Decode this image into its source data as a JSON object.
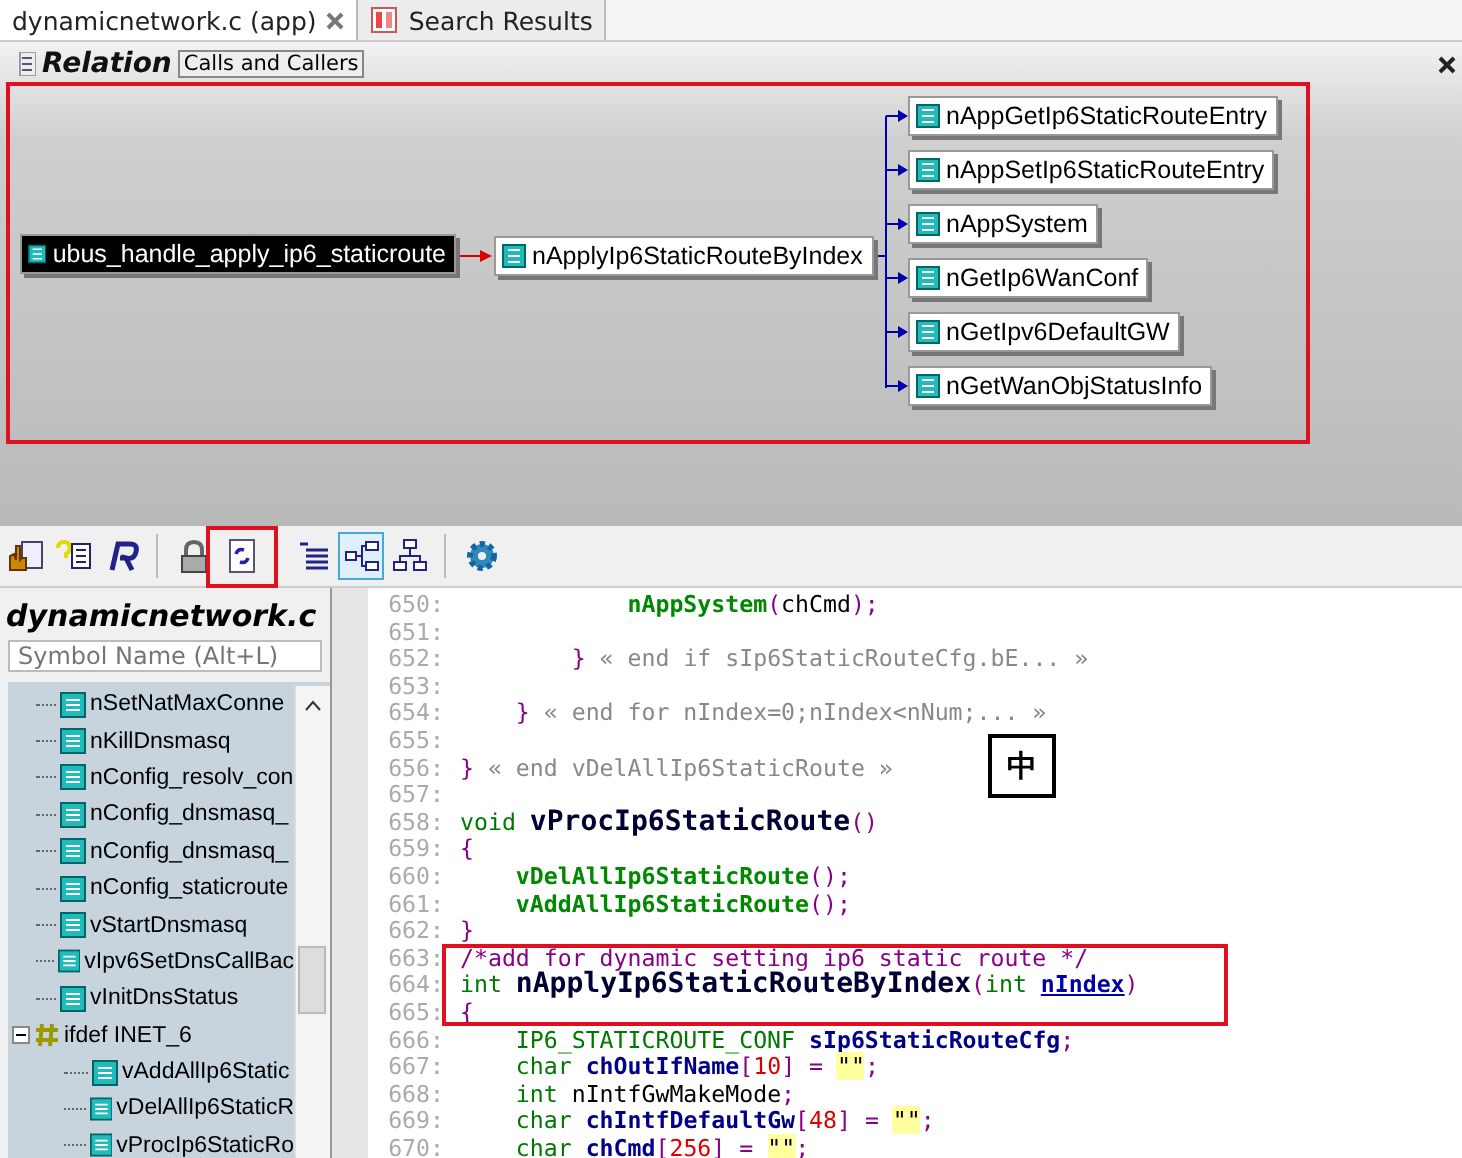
{
  "tabs": [
    {
      "label": "dynamicnetwork.c (app)",
      "selected": true,
      "kind": "file"
    },
    {
      "label": "Search Results",
      "selected": false,
      "kind": "search"
    }
  ],
  "relation": {
    "title": "Relation",
    "subtitle": "Calls and Callers",
    "root": {
      "label": "ubus_handle_apply_ip6_staticroute",
      "selected": true
    },
    "function": {
      "label": "nApplyIp6StaticRouteByIndex",
      "selected": false
    },
    "callees": [
      {
        "label": "nAppGetIp6StaticRouteEntry"
      },
      {
        "label": "nAppSetIp6StaticRouteEntry"
      },
      {
        "label": "nAppSystem"
      },
      {
        "label": "nGetIp6WanConf"
      },
      {
        "label": "nGetIpv6DefaultGW"
      },
      {
        "label": "nGetWanObjStatusInfo"
      }
    ]
  },
  "toolbar": [
    {
      "kind": "hand",
      "selected": false
    },
    {
      "kind": "help",
      "selected": false
    },
    {
      "kind": "r",
      "selected": false
    },
    {
      "kind": "sep"
    },
    {
      "kind": "lock",
      "selected": false
    },
    {
      "kind": "refresh",
      "selected": false
    },
    {
      "kind": "sep"
    },
    {
      "kind": "list",
      "selected": false
    },
    {
      "kind": "tree",
      "selected": true
    },
    {
      "kind": "hierarchy",
      "selected": false
    },
    {
      "kind": "sep"
    },
    {
      "kind": "gear",
      "selected": false
    }
  ],
  "symbols": {
    "title": "dynamicnetwork.c",
    "search": {
      "placeholder": "Symbol Name (Alt+L)"
    },
    "items": [
      {
        "label": "nSetNatMaxConne",
        "kind": "function"
      },
      {
        "label": "nKillDnsmasq",
        "kind": "function"
      },
      {
        "label": "nConfig_resolv_con",
        "kind": "function"
      },
      {
        "label": "nConfig_dnsmasq_",
        "kind": "function"
      },
      {
        "label": "nConfig_dnsmasq_",
        "kind": "function"
      },
      {
        "label": "nConfig_staticroute",
        "kind": "function"
      },
      {
        "label": "vStartDnsmasq",
        "kind": "function"
      },
      {
        "label": "vIpv6SetDnsCallBac",
        "kind": "function"
      },
      {
        "label": "vInitDnsStatus",
        "kind": "function"
      },
      {
        "label": "ifdef INET_6",
        "kind": "ifdef",
        "expanded": true,
        "children": [
          {
            "label": "vAddAllIp6Static",
            "kind": "function"
          },
          {
            "label": "vDelAllIp6StaticR",
            "kind": "function"
          },
          {
            "label": "vProcIp6StaticRo",
            "kind": "function"
          }
        ]
      }
    ]
  },
  "code": [
    {
      "n": "650:",
      "tokens": [
        {
          "t": "            nAppSystem",
          "kind": "call"
        },
        {
          "t": "(",
          "kind": "punct"
        },
        {
          "t": "chCmd",
          "kind": "plain"
        },
        {
          "t": ");",
          "kind": "punct"
        }
      ]
    },
    {
      "n": "651:"
    },
    {
      "n": "652:",
      "tokens": [
        {
          "t": "        }",
          "kind": "punct"
        },
        {
          "t": " « end if sIp6StaticRouteCfg.bE... »",
          "kind": "fold"
        }
      ]
    },
    {
      "n": "653:"
    },
    {
      "n": "654:",
      "tokens": [
        {
          "t": "    }",
          "kind": "punct"
        },
        {
          "t": " « end for nIndex=0;nIndex<nNum;... »",
          "kind": "fold"
        }
      ]
    },
    {
      "n": "655:"
    },
    {
      "n": "656:",
      "tokens": [
        {
          "t": "}",
          "kind": "punct"
        },
        {
          "t": " « end vDelAllIp6StaticRoute »",
          "kind": "fold"
        }
      ]
    },
    {
      "n": "657:"
    },
    {
      "n": "658:",
      "tokens": [
        {
          "t": "void ",
          "kind": "keyword"
        },
        {
          "t": "vProcIp6StaticRoute",
          "kind": "decl"
        },
        {
          "t": "()",
          "kind": "punct"
        }
      ]
    },
    {
      "n": "659:",
      "tokens": [
        {
          "t": "{",
          "kind": "punct"
        }
      ]
    },
    {
      "n": "660:",
      "tokens": [
        {
          "t": "    vDelAllIp6StaticRoute",
          "kind": "call"
        },
        {
          "t": "();",
          "kind": "punct"
        }
      ]
    },
    {
      "n": "661:",
      "tokens": [
        {
          "t": "    vAddAllIp6StaticRoute",
          "kind": "call"
        },
        {
          "t": "();",
          "kind": "punct"
        }
      ]
    },
    {
      "n": "662:",
      "tokens": [
        {
          "t": "}",
          "kind": "punct"
        }
      ]
    },
    {
      "n": "663:",
      "tokens": [
        {
          "t": "/*add for dynamic setting ip6 static route */",
          "kind": "comment"
        }
      ]
    },
    {
      "n": "664:",
      "tokens": [
        {
          "t": "int ",
          "kind": "keyword"
        },
        {
          "t": "nApplyIp6StaticRouteByIndex",
          "kind": "decl"
        },
        {
          "t": "(",
          "kind": "punct"
        },
        {
          "t": "int ",
          "kind": "keyword"
        },
        {
          "t": "nIndex",
          "kind": "param"
        },
        {
          "t": ")",
          "kind": "punct"
        }
      ]
    },
    {
      "n": "665:",
      "tokens": [
        {
          "t": "{",
          "kind": "punct"
        }
      ]
    },
    {
      "n": "666:",
      "tokens": [
        {
          "t": "    IP6_STATICROUTE_CONF ",
          "kind": "keyword"
        },
        {
          "t": "sIp6StaticRouteCfg",
          "kind": "var"
        },
        {
          "t": ";",
          "kind": "punct"
        }
      ]
    },
    {
      "n": "667:",
      "tokens": [
        {
          "t": "    char ",
          "kind": "keyword"
        },
        {
          "t": "chOutIfName",
          "kind": "var"
        },
        {
          "t": "[",
          "kind": "punct"
        },
        {
          "t": "10",
          "kind": "number"
        },
        {
          "t": "] = ",
          "kind": "punct"
        },
        {
          "t": "\"\"",
          "kind": "string"
        },
        {
          "t": ";",
          "kind": "punct"
        }
      ]
    },
    {
      "n": "668:",
      "tokens": [
        {
          "t": "    int ",
          "kind": "keyword"
        },
        {
          "t": "nIntfGwMakeMode",
          "kind": "plain"
        },
        {
          "t": ";",
          "kind": "punct"
        }
      ]
    },
    {
      "n": "669:",
      "tokens": [
        {
          "t": "    char ",
          "kind": "keyword"
        },
        {
          "t": "chIntfDefaultGw",
          "kind": "var"
        },
        {
          "t": "[",
          "kind": "punct"
        },
        {
          "t": "48",
          "kind": "number"
        },
        {
          "t": "] = ",
          "kind": "punct"
        },
        {
          "t": "\"\"",
          "kind": "string"
        },
        {
          "t": ";",
          "kind": "punct"
        }
      ]
    },
    {
      "n": "670:",
      "tokens": [
        {
          "t": "    char ",
          "kind": "keyword"
        },
        {
          "t": "chCmd",
          "kind": "var"
        },
        {
          "t": "[",
          "kind": "punct"
        },
        {
          "t": "256",
          "kind": "number"
        },
        {
          "t": "] = ",
          "kind": "punct"
        },
        {
          "t": "\"\"",
          "kind": "string"
        },
        {
          "t": ";",
          "kind": "punct"
        }
      ]
    }
  ],
  "ime_indicator": "中"
}
